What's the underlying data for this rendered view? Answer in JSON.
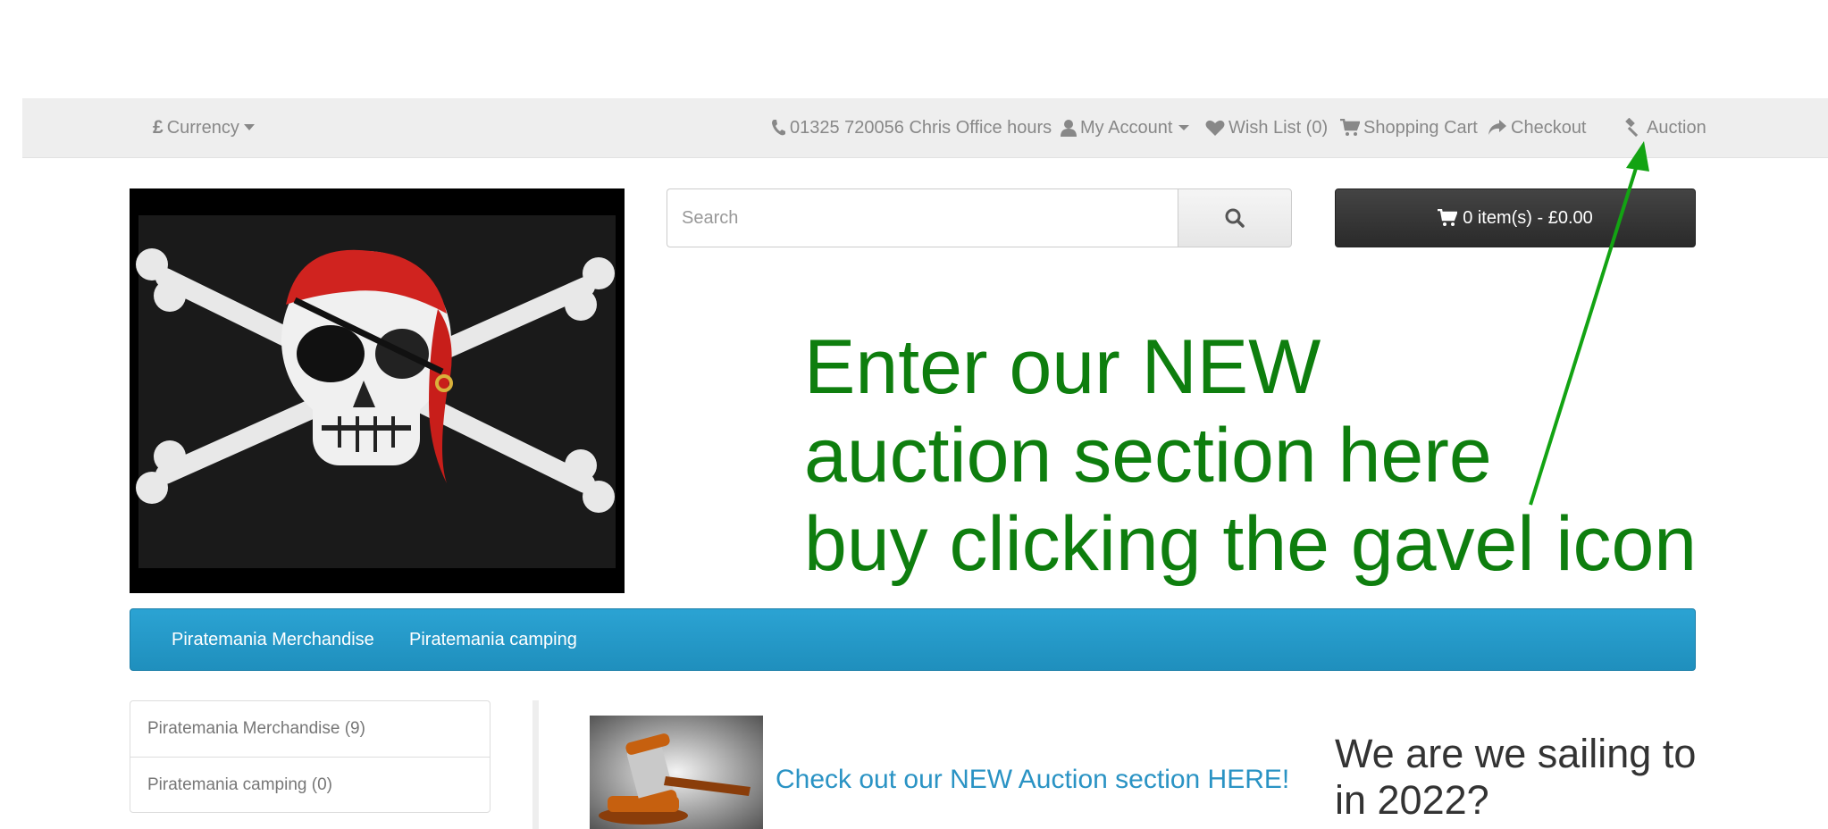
{
  "topbar": {
    "currency_label": "Currency",
    "phone_label": "01325 720056 Chris Office hours",
    "my_account_label": "My Account",
    "wishlist_label": "Wish List (0)",
    "cart_label": "Shopping Cart",
    "checkout_label": "Checkout",
    "auction_label": "Auction"
  },
  "search": {
    "placeholder": "Search",
    "value": ""
  },
  "cart": {
    "label": "0 item(s) - £0.00"
  },
  "annotation": {
    "lines": [
      "Enter our NEW",
      "auction section here",
      "buy clicking the gavel icon"
    ],
    "color": "#0e7e0e"
  },
  "menu": {
    "items": [
      {
        "label": "Piratemania Merchandise"
      },
      {
        "label": "Piratemania camping"
      }
    ],
    "color": "#2aa0d0"
  },
  "categories": [
    {
      "label": "Piratemania Merchandise (9)"
    },
    {
      "label": "Piratemania camping (0)"
    }
  ],
  "content": {
    "auction_link": "Check out our NEW Auction section HERE!",
    "sailing_heading": "We are we sailing to in 2022?"
  },
  "icons": {
    "currency": "pound-icon",
    "phone": "phone-icon",
    "account": "user-icon",
    "wishlist": "heart-icon",
    "cart": "cart-icon",
    "checkout": "share-icon",
    "auction": "gavel-icon",
    "search": "search-icon"
  }
}
